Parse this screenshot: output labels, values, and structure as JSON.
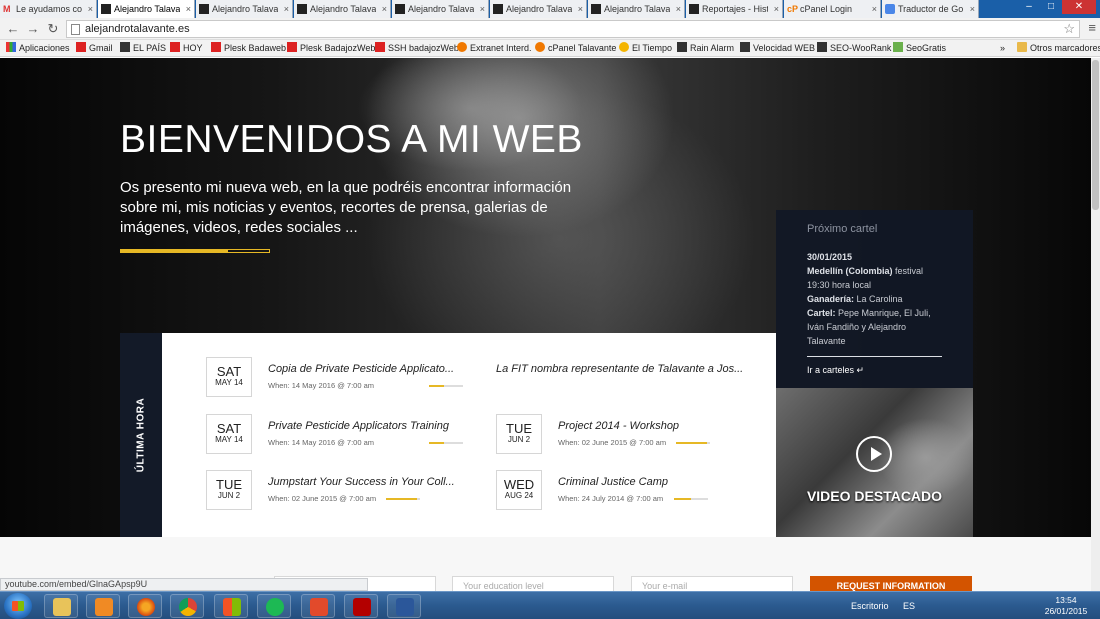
{
  "browser": {
    "tabs": [
      {
        "label": "Le ayudamos co",
        "icon": "gmail-icon"
      },
      {
        "label": "Alejandro Talava",
        "icon": "site-icon",
        "active": true
      },
      {
        "label": "Alejandro Talava",
        "icon": "site-icon"
      },
      {
        "label": "Alejandro Talava",
        "icon": "site-icon"
      },
      {
        "label": "Alejandro Talava",
        "icon": "site-icon"
      },
      {
        "label": "Alejandro Talava",
        "icon": "site-icon"
      },
      {
        "label": "Alejandro Talava",
        "icon": "site-icon"
      },
      {
        "label": "Reportajes - Hist",
        "icon": "site-icon"
      },
      {
        "label": "cPanel Login",
        "icon": "cpanel-icon"
      },
      {
        "label": "Traductor de Go",
        "icon": "translate-icon"
      }
    ],
    "tab_close": "×",
    "window_controls": {
      "minimize": "–",
      "maximize": "□",
      "close": "✕"
    },
    "nav": {
      "back": "←",
      "forward": "→",
      "reload": "↻"
    },
    "url": "alejandrotalavante.es",
    "star": "☆",
    "menu": "≡",
    "bookmarks": [
      {
        "label": "Aplicaciones",
        "icon": "grid"
      },
      {
        "label": "Gmail",
        "icon": "red"
      },
      {
        "label": "EL PAÍS",
        "icon": "dark"
      },
      {
        "label": "HOY",
        "icon": "red"
      },
      {
        "label": "Plesk Badaweb",
        "icon": "red"
      },
      {
        "label": "Plesk BadajozWeb",
        "icon": "red"
      },
      {
        "label": "SSH badajozWeb",
        "icon": "red"
      },
      {
        "label": "Extranet Interd.",
        "icon": "orange"
      },
      {
        "label": "cPanel Talavante",
        "icon": "orange"
      },
      {
        "label": "El Tiempo",
        "icon": "sun"
      },
      {
        "label": "Rain Alarm",
        "icon": "dark"
      },
      {
        "label": "Velocidad WEB",
        "icon": "dark"
      },
      {
        "label": "SEO-WooRank",
        "icon": "dark"
      },
      {
        "label": "SeoGratis",
        "icon": "green"
      }
    ],
    "bookmarks_more": "»",
    "other_bookmarks": "Otros marcadores"
  },
  "hero": {
    "title": "BIENVENIDOS A MI WEB",
    "text": "Os presento mi nueva web, en la que podréis encontrar información sobre mi, mis noticias y eventos, recortes de prensa, galerias de imágenes, videos, redes sociales ...",
    "progress": 0.72
  },
  "cartel": {
    "title": "Próximo cartel",
    "date": "30/01/2015",
    "place": "Medellín (Colombia)",
    "event": " festival",
    "time": "19:30 hora local",
    "ganaderia_label": "Ganadería:",
    "ganaderia": " La Carolina",
    "cartel_label": "Cartel:",
    "cartel_text": " Pepe Manrique, El Juli, Iván Fandiño y Alejandro Talavante",
    "link": "Ir a carteles ↵"
  },
  "video": {
    "label": "VIDEO DESTACADO"
  },
  "ultima_hora": {
    "label": "ÚLTIMA HORA"
  },
  "events": [
    {
      "dow": "SAT",
      "dm": "MAY 14",
      "title": "Copia de Private Pesticide Applicato...",
      "when": "When: 14 May 2016 @ 7:00 am",
      "progress": 0.45
    },
    {
      "dow": "",
      "dm": "",
      "title": "La FIT nombra representante de Talavante a Jos...",
      "when": "",
      "progress": 0
    },
    {
      "dow": "SAT",
      "dm": "MAY 14",
      "title": "Private Pesticide Applicators Training",
      "when": "When: 14 May 2016 @ 7:00 am",
      "progress": 0.45
    },
    {
      "dow": "TUE",
      "dm": "JUN 2",
      "title": "Project 2014 - Workshop",
      "when": "When: 02 June 2015 @ 7:00 am",
      "progress": 0.9
    },
    {
      "dow": "TUE",
      "dm": "JUN 2",
      "title": "Jumpstart Your Success in Your Coll...",
      "when": "When: 02 June 2015 @ 7:00 am",
      "progress": 0.9
    },
    {
      "dow": "WED",
      "dm": "AUG 24",
      "title": "Criminal Justice Camp",
      "when": "When: 24 July 2014 @ 7:00 am",
      "progress": 0.5
    }
  ],
  "form": {
    "education_placeholder": "Your education level",
    "email_placeholder": "Your e-mail",
    "button": "REQUEST INFORMATION"
  },
  "status_url": "youtube.com/embed/GlnaGApsp9U",
  "taskbar": {
    "desktop": "Escritorio",
    "lang": "ES",
    "time": "13:54",
    "date": "26/01/2015"
  },
  "colors": {
    "accent": "#e6b825",
    "dark_panel": "#131a28",
    "button": "#d35400"
  }
}
